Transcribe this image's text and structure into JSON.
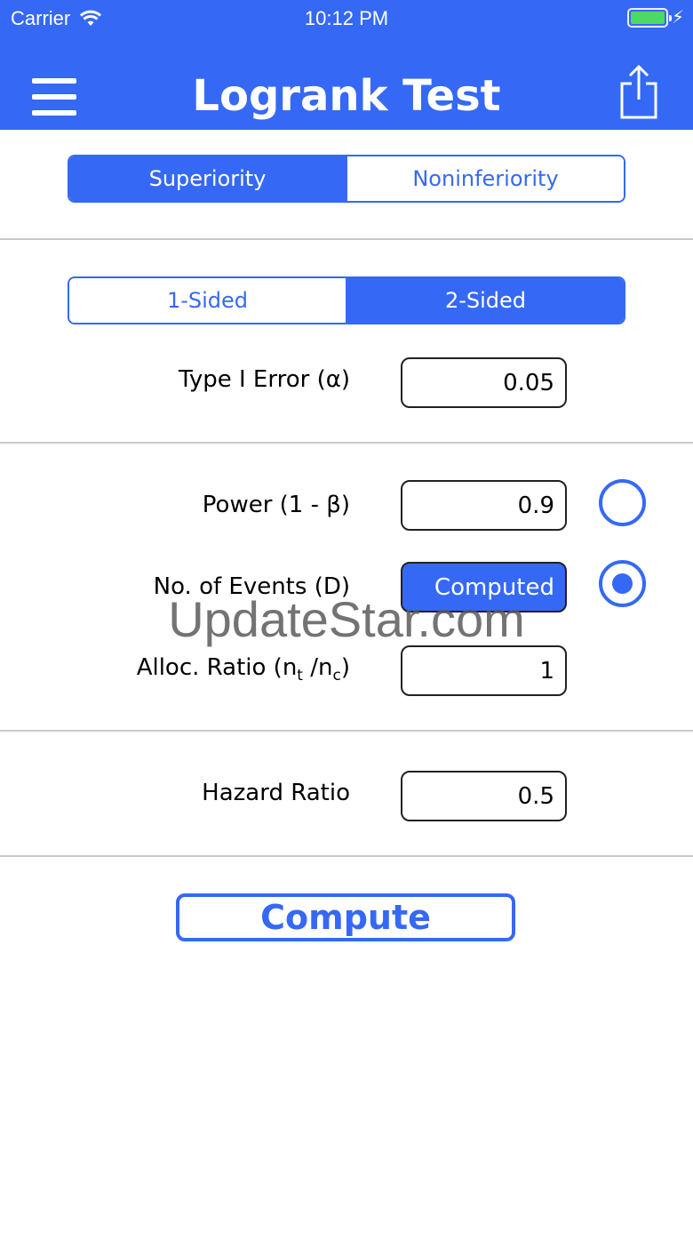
{
  "status_bar": {
    "carrier": "Carrier",
    "time": "10:12 PM"
  },
  "header": {
    "title": "Logrank Test",
    "menu_icon": "hamburger-menu-icon",
    "share_icon": "share-icon"
  },
  "hypothesis_type": {
    "options": [
      "Superiority",
      "Noninferiority"
    ],
    "selected": "Superiority"
  },
  "sidedness": {
    "options": [
      "1-Sided",
      "2-Sided"
    ],
    "selected": "2-Sided"
  },
  "fields": {
    "type1_error": {
      "label": "Type I Error (α)",
      "value": "0.05"
    },
    "power": {
      "label": "Power (1 - β)",
      "value": "0.9",
      "radio_selected": false
    },
    "events": {
      "label": "No. of Events (D)",
      "value": "Computed",
      "radio_selected": true
    },
    "alloc_ratio": {
      "label_main": "Alloc. Ratio (n",
      "sub_t": "t",
      "label_mid": " /n",
      "sub_c": "c",
      "label_end": ")",
      "value": "1"
    },
    "hazard_ratio": {
      "label": "Hazard Ratio",
      "value": "0.5"
    }
  },
  "compute_button": {
    "label": "Compute"
  },
  "watermark": "UpdateStar.com",
  "colors": {
    "accent": "#3569f5",
    "battery": "#4cd964"
  }
}
